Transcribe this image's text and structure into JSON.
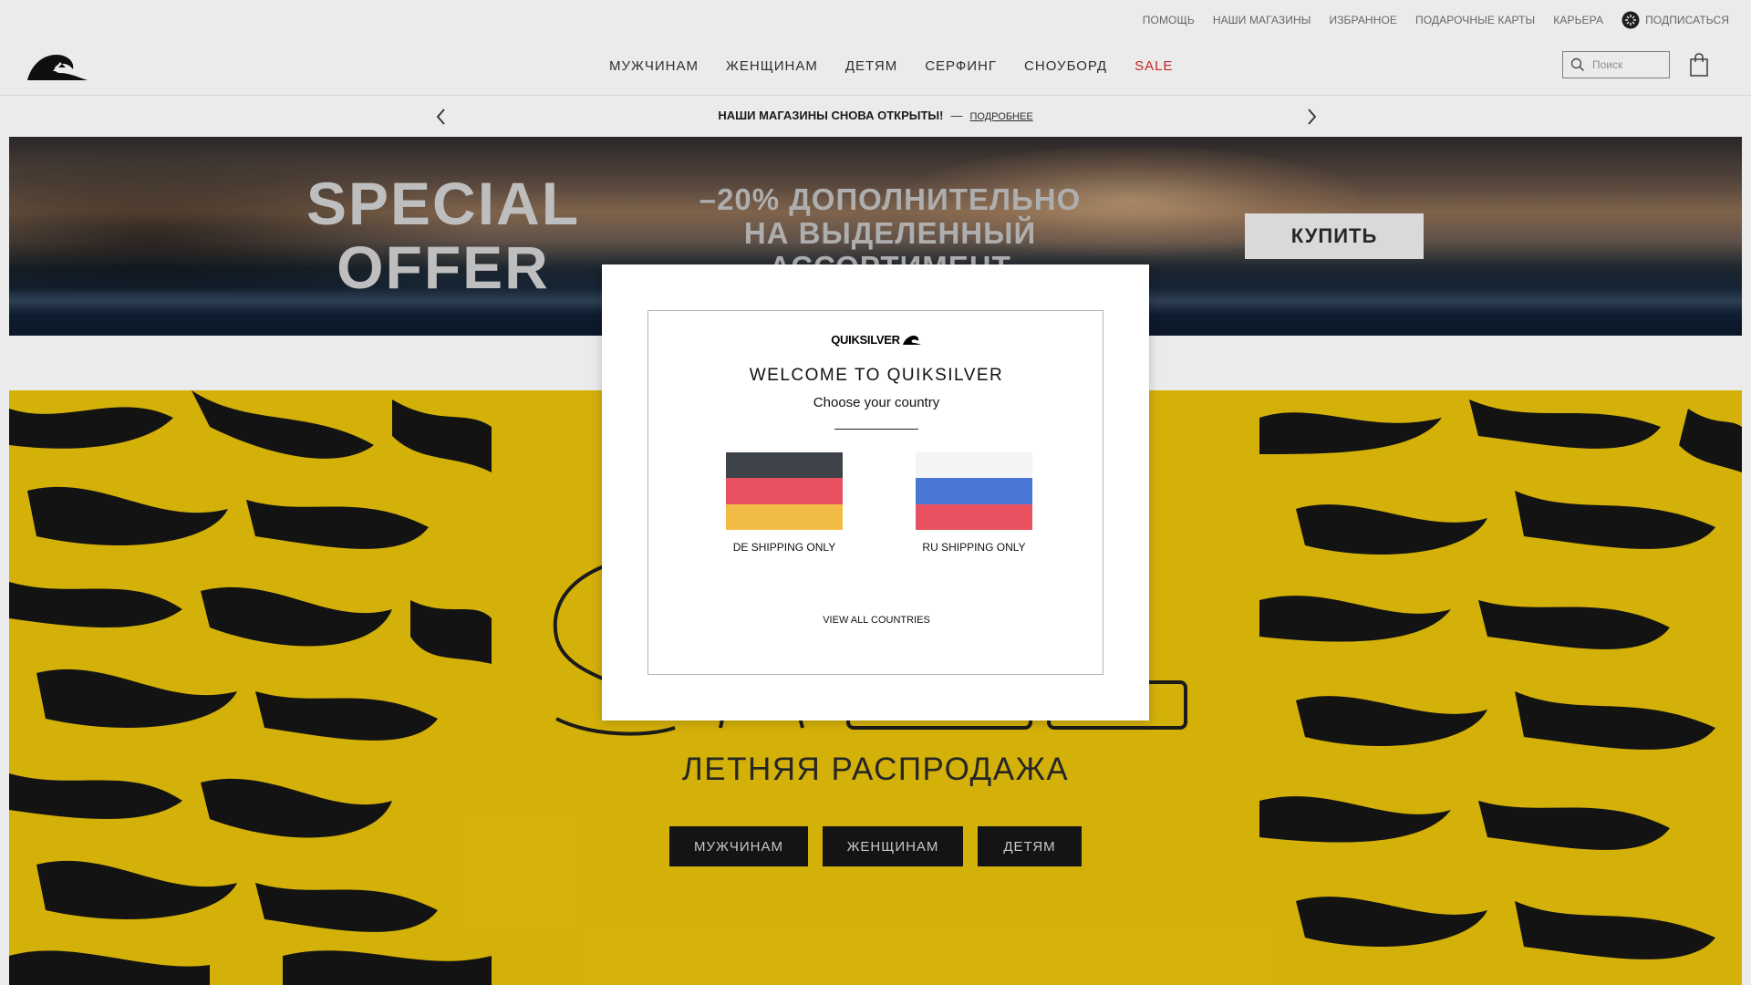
{
  "utility": {
    "links": [
      "ПОМОЩЬ",
      "НАШИ МАГАЗИНЫ",
      "ИЗБРАННОЕ",
      "ПОДАРОЧНЫЕ КАРТЫ",
      "КАРЬЕРА"
    ],
    "subscribe": "ПОДПИСАТЬСЯ",
    "subscribe_icon": "subscribe-badge-icon"
  },
  "header": {
    "logo_icon": "quiksilver-wave-logo",
    "nav": [
      "МУЖЧИНАМ",
      "ЖЕНЩИНАМ",
      "ДЕТЯМ",
      "СЕРФИНГ",
      "СНОУБОРД",
      "SALE"
    ],
    "sale_color": "#d22a2a",
    "search_placeholder": "Поиск",
    "search_icon": "magnifier",
    "bag_icon": "shopping-bag"
  },
  "promo": {
    "message": "НАШИ МАГАЗИНЫ СНОВА ОТКРЫТЫ!",
    "separator": "—",
    "link": "ПОДРОБНЕЕ",
    "prev_icon": "chevron-left",
    "next_icon": "chevron-right"
  },
  "hero": {
    "headline_lines": [
      "SPECIAL",
      "OFFER"
    ],
    "offer_lines": [
      "–20% ДОПОЛНИТЕЛЬНО",
      "НА ВЫДЕЛЕННЫЙ",
      "АССОРТИМЕНТ"
    ],
    "cta": "КУПИТЬ"
  },
  "sale_section": {
    "background": "#e7c10a",
    "title": "ЛЕТНЯЯ РАСПРОДАЖА",
    "buttons": [
      "МУЖЧИНАМ",
      "ЖЕНЩИНАМ",
      "ДЕТЯМ"
    ]
  },
  "modal": {
    "brand": "QUIKSILVER",
    "welcome": "WELCOME TO QUIKSILVER",
    "subtitle": "Choose your country",
    "countries": [
      {
        "label": "DE SHIPPING ONLY",
        "flag_colors": [
          "#3d4348",
          "#e8515f",
          "#f2bb46"
        ]
      },
      {
        "label": "RU SHIPPING ONLY",
        "flag_colors": [
          "#f4f4f4",
          "#4a76d6",
          "#e8515f"
        ]
      }
    ],
    "view_all": "VIEW ALL COUNTRIES"
  }
}
